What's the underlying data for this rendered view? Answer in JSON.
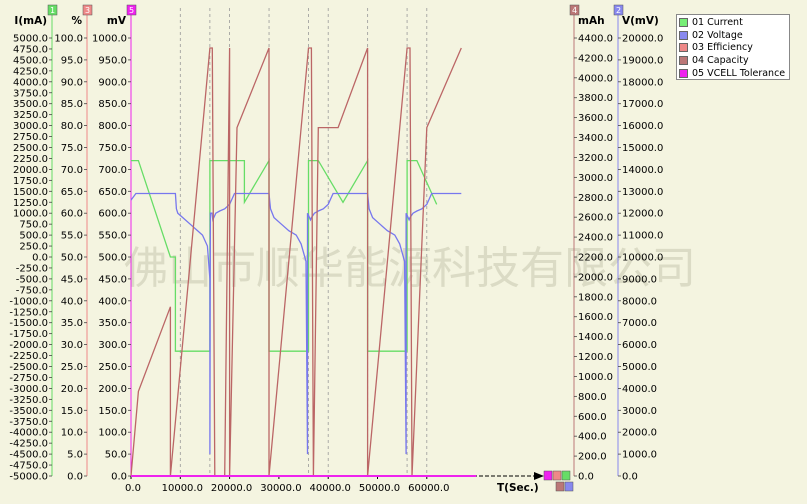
{
  "chart_data": {
    "type": "line",
    "xlabel": "T(Sec.)",
    "x_ticks": [
      0,
      10000,
      20000,
      30000,
      40000,
      50000,
      60000
    ],
    "x_tick_labels": [
      "0.0",
      "10000.0",
      "20000.0",
      "30000.0",
      "40000.0",
      "50000.0",
      "60000.0"
    ],
    "xlim": [
      0,
      70000
    ],
    "cycle_boundaries_x": [
      10000,
      16000,
      20000,
      28000,
      36000,
      40000,
      48000,
      56000,
      60000
    ],
    "axes": [
      {
        "id": "1",
        "label": "I(mA)",
        "color": "#66dd66",
        "min": -5000,
        "max": 5000,
        "step": 250,
        "decimals": 1,
        "side": "left"
      },
      {
        "id": "3",
        "label": "%",
        "color": "#ee8888",
        "min": 0,
        "max": 100,
        "step": 5,
        "decimals": 1,
        "side": "left"
      },
      {
        "id": "5",
        "label": "mV",
        "color": "#ee22ee",
        "min": 0,
        "max": 1000,
        "step": 50,
        "decimals": 1,
        "side": "left"
      },
      {
        "id": "4",
        "label": "mAh",
        "color": "#bb7777",
        "min": 0,
        "max": 4400,
        "step": 200,
        "decimals": 1,
        "side": "right"
      },
      {
        "id": "2",
        "label": "V(mV)",
        "color": "#8888ee",
        "min": 0,
        "max": 20000,
        "step": 1000,
        "decimals": 1,
        "side": "right"
      }
    ],
    "series": [
      {
        "name": "01 Current",
        "axis": "1",
        "color": "#66dd66",
        "x": [
          0,
          1500,
          8000,
          8000,
          9000,
          9000,
          16000,
          16000,
          17000,
          23000,
          23000,
          28000,
          28000,
          30000,
          32000,
          36000,
          36000,
          38000,
          43000,
          43000,
          48000,
          48000,
          50000,
          52000,
          56000,
          56000,
          58000,
          62000
        ],
        "y": [
          2200,
          2200,
          0,
          0,
          0,
          -2150,
          -2150,
          2200,
          2200,
          2200,
          1250,
          2200,
          -2150,
          -2150,
          -2150,
          -2150,
          2200,
          2200,
          1250,
          1250,
          2200,
          -2150,
          -2150,
          -2150,
          -2150,
          2200,
          2200,
          1200
        ]
      },
      {
        "name": "02 Voltage",
        "axis": "2",
        "color": "#7777ee",
        "x": [
          0,
          1000,
          3000,
          9000,
          9200,
          9500,
          10500,
          12000,
          13500,
          14500,
          15500,
          16000,
          16000,
          16100,
          16400,
          16600,
          16800,
          17200,
          18000,
          19000,
          20000,
          21000,
          22000,
          23000,
          23200,
          28000,
          28300,
          29000,
          30500,
          32000,
          33500,
          34500,
          35500,
          35800,
          35800,
          36400,
          36600,
          37200,
          38000,
          39000,
          40000,
          41000,
          42000,
          42500,
          42800,
          48000,
          48300,
          49000,
          50500,
          52000,
          53500,
          54500,
          55500,
          55800,
          55800,
          56400,
          56600,
          57200,
          58000,
          59000,
          60000,
          61000,
          62000,
          67000
        ],
        "y": [
          12600,
          12900,
          12900,
          12900,
          12200,
          12000,
          11800,
          11500,
          11200,
          11000,
          10500,
          9000,
          1000,
          12000,
          12000,
          11700,
          11800,
          12000,
          12100,
          12200,
          12400,
          12900,
          12900,
          12900,
          12900,
          12900,
          12200,
          11800,
          11500,
          11200,
          11000,
          10600,
          9800,
          1000,
          12000,
          11700,
          11800,
          12000,
          12100,
          12200,
          12400,
          12900,
          12900,
          12900,
          12900,
          12900,
          12200,
          11800,
          11500,
          11200,
          11000,
          10600,
          9800,
          1000,
          12000,
          11700,
          11800,
          12000,
          12100,
          12200,
          12400,
          12900,
          12900,
          12900
        ]
      },
      {
        "name": "03 Efficiency",
        "axis": "3",
        "color": "#ee8888",
        "x": [],
        "y": []
      },
      {
        "name": "04 Capacity",
        "axis": "4",
        "color": "#bb6666",
        "x": [
          0,
          1500,
          8000,
          8000,
          16000,
          16300,
          16500,
          17000,
          17000,
          19000,
          20000,
          20000,
          20000,
          21500,
          28000,
          28000,
          36000,
          36500,
          36600,
          37000,
          37000,
          38000,
          42000,
          48000,
          48000,
          56000,
          56500,
          56600,
          57000,
          57000,
          60000,
          67000
        ],
        "y": [
          0,
          850,
          1700,
          0,
          4300,
          4300,
          4300,
          0,
          0,
          0,
          4300,
          4300,
          0,
          3500,
          4300,
          0,
          4300,
          4300,
          4300,
          0,
          0,
          3500,
          3500,
          4300,
          0,
          4300,
          4300,
          4300,
          0,
          0,
          3500,
          4300
        ]
      },
      {
        "name": "05 VCELL Tolerance",
        "axis": "5",
        "color": "#ee22ee",
        "x": [
          0,
          70000
        ],
        "y": [
          0,
          0
        ]
      }
    ],
    "legend_position": "top-right",
    "grid": false
  },
  "legend": [
    {
      "label": "01 Current",
      "color": "#77ee77"
    },
    {
      "label": "02 Voltage",
      "color": "#8888ee"
    },
    {
      "label": "03 Efficiency",
      "color": "#ee8888"
    },
    {
      "label": "04 Capacity",
      "color": "#bb7777"
    },
    {
      "label": "05 VCELL Tolerance",
      "color": "#ee22ee"
    }
  ],
  "watermark": "佛山市顺华能源科技有限公司"
}
